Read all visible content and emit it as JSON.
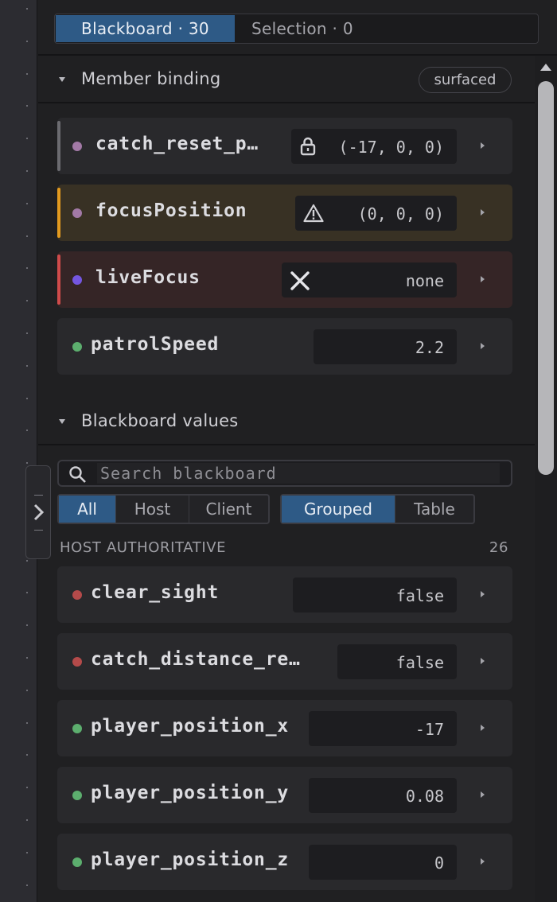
{
  "tabs": {
    "blackboard": "Blackboard · 30",
    "selection": "Selection · 0"
  },
  "member_binding": {
    "title": "Member binding",
    "badge": "surfaced",
    "rows": [
      {
        "name": "catch_reset_p…",
        "value": "(-17, 0, 0)",
        "icon": "lock-icon",
        "status": "neutral",
        "dot_color": "#a279a6",
        "accent": "#6b6b70"
      },
      {
        "name": "focusPosition",
        "value": "(0, 0, 0)",
        "icon": "warning-icon",
        "status": "warning",
        "dot_color": "#a279a6",
        "accent": "#e29a1f"
      },
      {
        "name": "liveFocus",
        "value": "none",
        "icon": "close-icon",
        "status": "error",
        "dot_color": "#7456e0",
        "accent": "#cf4b4b"
      },
      {
        "name": "patrolSpeed",
        "value": "2.2",
        "icon": "",
        "status": "ok",
        "dot_color": "#5cae6e",
        "accent": ""
      }
    ]
  },
  "blackboard_values": {
    "title": "Blackboard values",
    "search_placeholder": "Search blackboard",
    "filters": [
      "All",
      "Host",
      "Client"
    ],
    "views": [
      "Grouped",
      "Table"
    ],
    "group": {
      "label": "HOST AUTHORITATIVE",
      "count": "26"
    },
    "rows": [
      {
        "name": "clear_sight",
        "value": "false",
        "dot_color": "#b44a4a"
      },
      {
        "name": "catch_distance_re…",
        "value": "false",
        "dot_color": "#b44a4a"
      },
      {
        "name": "player_position_x",
        "value": "-17",
        "dot_color": "#5cae6e"
      },
      {
        "name": "player_position_y",
        "value": "0.08",
        "dot_color": "#5cae6e"
      },
      {
        "name": "player_position_z",
        "value": "0",
        "dot_color": "#5cae6e"
      }
    ]
  }
}
